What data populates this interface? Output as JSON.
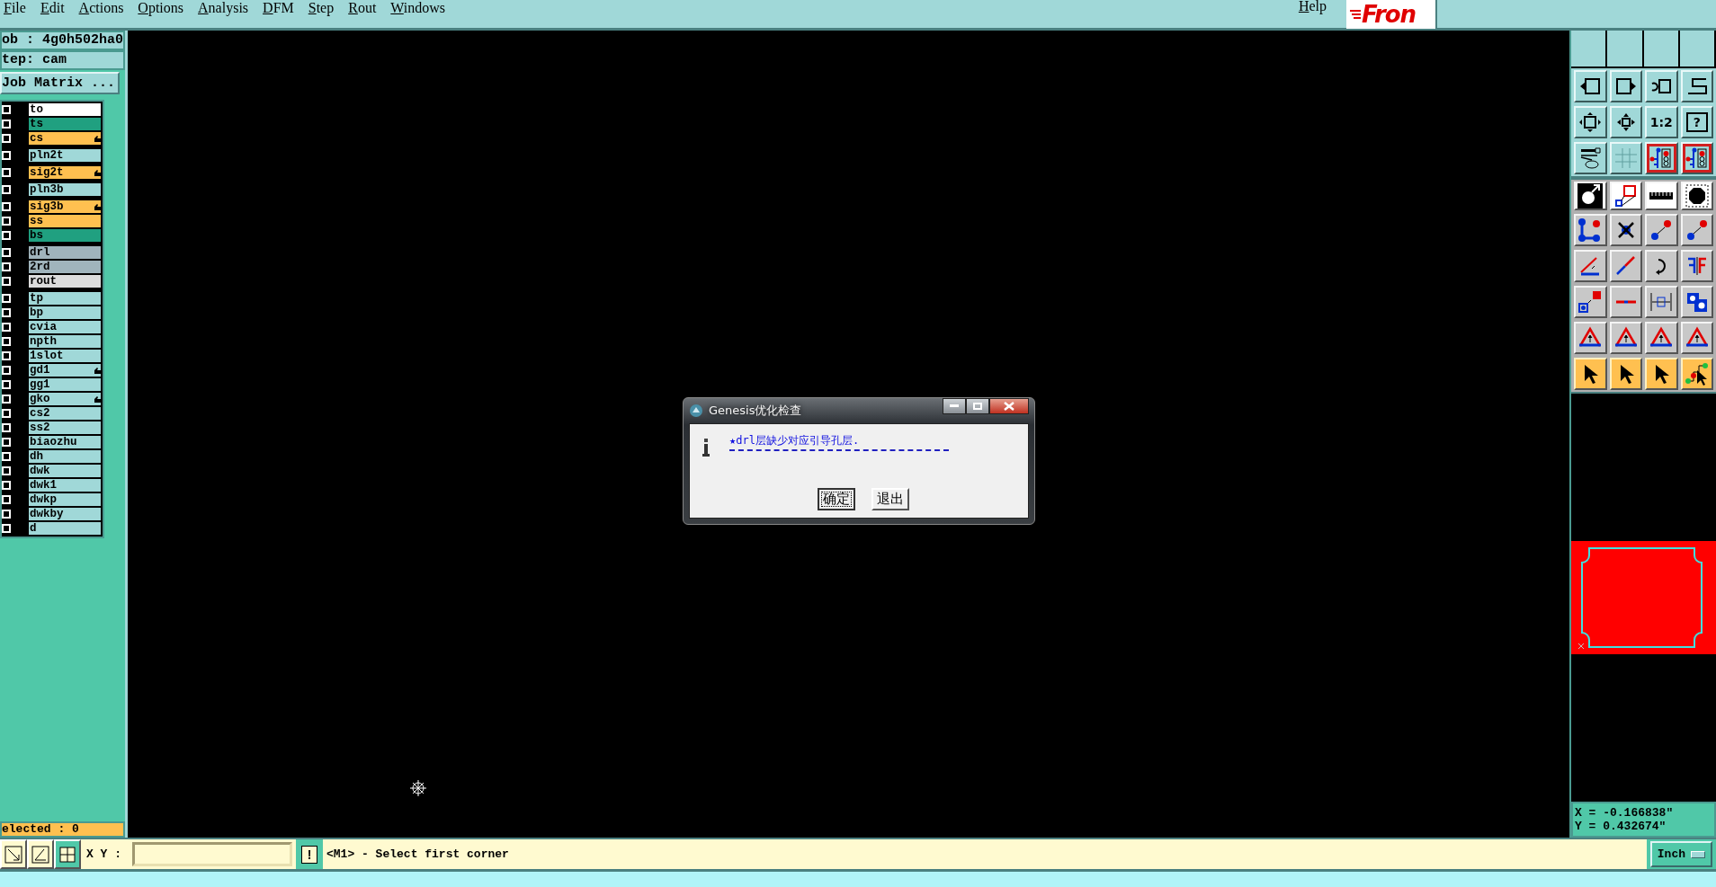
{
  "menu": [
    {
      "label": "File"
    },
    {
      "label": "Edit"
    },
    {
      "label": "Actions"
    },
    {
      "label": "Options"
    },
    {
      "label": "Analysis"
    },
    {
      "label": "DFM"
    },
    {
      "label": "Step"
    },
    {
      "label": "Rout"
    },
    {
      "label": "Windows"
    }
  ],
  "help": "Help",
  "logo": "Fron",
  "job": "ob : 4g0h502ha0",
  "step": "tep: cam",
  "job_matrix": "Job Matrix ...",
  "layer_groups": [
    {
      "layers": [
        {
          "name": "to",
          "color": "#ffffff",
          "checked": false,
          "flagged": false
        },
        {
          "name": "ts",
          "color": "#20a080",
          "checked": false,
          "flagged": false
        },
        {
          "name": "cs",
          "color": "#ffc050",
          "checked": false,
          "flagged": true
        }
      ]
    },
    {
      "layers": [
        {
          "name": "pln2t",
          "color": "#a0d8d8",
          "checked": false,
          "flagged": false
        }
      ]
    },
    {
      "layers": [
        {
          "name": "sig2t",
          "color": "#ffc050",
          "checked": false,
          "flagged": true
        }
      ]
    },
    {
      "layers": [
        {
          "name": "pln3b",
          "color": "#a0d8d8",
          "checked": false,
          "flagged": false
        }
      ]
    },
    {
      "layers": [
        {
          "name": "sig3b",
          "color": "#ffc050",
          "checked": false,
          "flagged": true
        },
        {
          "name": "ss",
          "color": "#ffc050",
          "checked": false,
          "flagged": false
        },
        {
          "name": "bs",
          "color": "#20a080",
          "checked": false,
          "flagged": false
        }
      ]
    },
    {
      "layers": [
        {
          "name": "drl",
          "color": "#a0b4bc",
          "checked": false,
          "flagged": false
        },
        {
          "name": "2rd",
          "color": "#a0b4bc",
          "checked": false,
          "flagged": false
        },
        {
          "name": "rout",
          "color": "#dcdcdc",
          "checked": false,
          "flagged": false
        }
      ]
    },
    {
      "layers": [
        {
          "name": "tp",
          "color": "#a0d8d8",
          "checked": false,
          "flagged": false
        },
        {
          "name": "bp",
          "color": "#a0d8d8",
          "checked": false,
          "flagged": false
        },
        {
          "name": "cvia",
          "color": "#a0d8d8",
          "checked": false,
          "flagged": false
        },
        {
          "name": "npth",
          "color": "#a0d8d8",
          "checked": false,
          "flagged": false
        },
        {
          "name": "1slot",
          "color": "#a0d8d8",
          "checked": false,
          "flagged": false
        },
        {
          "name": "gd1",
          "color": "#a0d8d8",
          "checked": false,
          "flagged": true
        },
        {
          "name": "gg1",
          "color": "#a0d8d8",
          "checked": false,
          "flagged": false
        },
        {
          "name": "gko",
          "color": "#a0d8d8",
          "checked": false,
          "flagged": true
        },
        {
          "name": "cs2",
          "color": "#a0d8d8",
          "checked": false,
          "flagged": false
        },
        {
          "name": "ss2",
          "color": "#a0d8d8",
          "checked": false,
          "flagged": false
        },
        {
          "name": "biaozhu",
          "color": "#a0d8d8",
          "checked": false,
          "flagged": false
        },
        {
          "name": "dh",
          "color": "#a0d8d8",
          "checked": false,
          "flagged": false
        },
        {
          "name": "dwk",
          "color": "#a0d8d8",
          "checked": false,
          "flagged": false
        },
        {
          "name": "dwk1",
          "color": "#a0d8d8",
          "checked": false,
          "flagged": false
        },
        {
          "name": "dwkp",
          "color": "#a0d8d8",
          "checked": false,
          "flagged": false
        },
        {
          "name": "dwkby",
          "color": "#a0d8d8",
          "checked": false,
          "flagged": false
        },
        {
          "name": "d",
          "color": "#a0d8d8",
          "checked": false,
          "flagged": false
        }
      ]
    }
  ],
  "selected_count": "elected : 0",
  "dialog": {
    "title": "Genesis优化检查",
    "message": "★drl层缺少对应引导孔层.",
    "buttons": [
      {
        "label": "确定",
        "focused": true
      },
      {
        "label": "退出",
        "focused": false
      }
    ]
  },
  "toolbar": [
    {
      "kind": "teal",
      "buttons": [
        {
          "kind": "square-left",
          "highlighted": false
        },
        {
          "kind": "square-right",
          "highlighted": false
        },
        {
          "kind": "undo",
          "highlighted": false
        },
        {
          "kind": "s-curve",
          "highlighted": false
        }
      ]
    },
    {
      "kind": "teal",
      "buttons": [
        {
          "kind": "fit",
          "highlighted": false
        },
        {
          "kind": "zoom",
          "highlighted": false
        },
        {
          "kind": "text",
          "label": "1:2",
          "highlighted": false
        },
        {
          "kind": "boxed-text",
          "label": "?",
          "highlighted": false
        }
      ]
    },
    {
      "kind": "teal",
      "buttons": [
        {
          "kind": "tools",
          "highlighted": false
        },
        {
          "kind": "grid",
          "highlighted": false
        },
        {
          "kind": "circuit",
          "highlighted": true
        },
        {
          "kind": "circuit",
          "highlighted": true
        }
      ]
    },
    {
      "kind": "white",
      "buttons": [
        {
          "kind": "circle-arrow",
          "highlighted": false
        },
        {
          "kind": "squares",
          "highlighted": false
        },
        {
          "kind": "ruler",
          "highlighted": false
        },
        {
          "kind": "octagon",
          "highlighted": false
        }
      ]
    },
    {
      "kind": "gray",
      "buttons": [
        {
          "kind": "nodes",
          "highlighted": false
        },
        {
          "kind": "cross",
          "highlighted": false
        },
        {
          "kind": "dot-arrow",
          "highlighted": false
        },
        {
          "kind": "dot-arrow",
          "highlighted": false
        }
      ]
    },
    {
      "kind": "gray",
      "buttons": [
        {
          "kind": "angle",
          "highlighted": false
        },
        {
          "kind": "line",
          "highlighted": false
        },
        {
          "kind": "rotate",
          "highlighted": false
        },
        {
          "kind": "mirror",
          "highlighted": false
        }
      ]
    },
    {
      "kind": "gray",
      "buttons": [
        {
          "kind": "squares-arrow",
          "highlighted": false
        },
        {
          "kind": "dash",
          "highlighted": false
        },
        {
          "kind": "measure",
          "highlighted": false
        },
        {
          "kind": "blobs",
          "highlighted": false
        }
      ]
    },
    {
      "kind": "gray",
      "buttons": [
        {
          "kind": "triangle",
          "highlighted": false
        },
        {
          "kind": "triangle",
          "highlighted": false
        },
        {
          "kind": "triangle",
          "highlighted": false
        },
        {
          "kind": "triangle",
          "highlighted": false
        }
      ]
    },
    {
      "kind": "orange",
      "buttons": [
        {
          "kind": "pointer",
          "highlighted": false
        },
        {
          "kind": "pointer",
          "highlighted": false
        },
        {
          "kind": "pointer",
          "highlighted": false
        },
        {
          "kind": "path-pointer",
          "highlighted": false
        }
      ]
    }
  ],
  "coordinates": {
    "x": "X = -0.166838\"",
    "y": "Y = 0.432674\""
  },
  "xy_label": "X Y :",
  "command_button": "!",
  "prompt": "<M1> - Select first corner",
  "units": "Inch"
}
